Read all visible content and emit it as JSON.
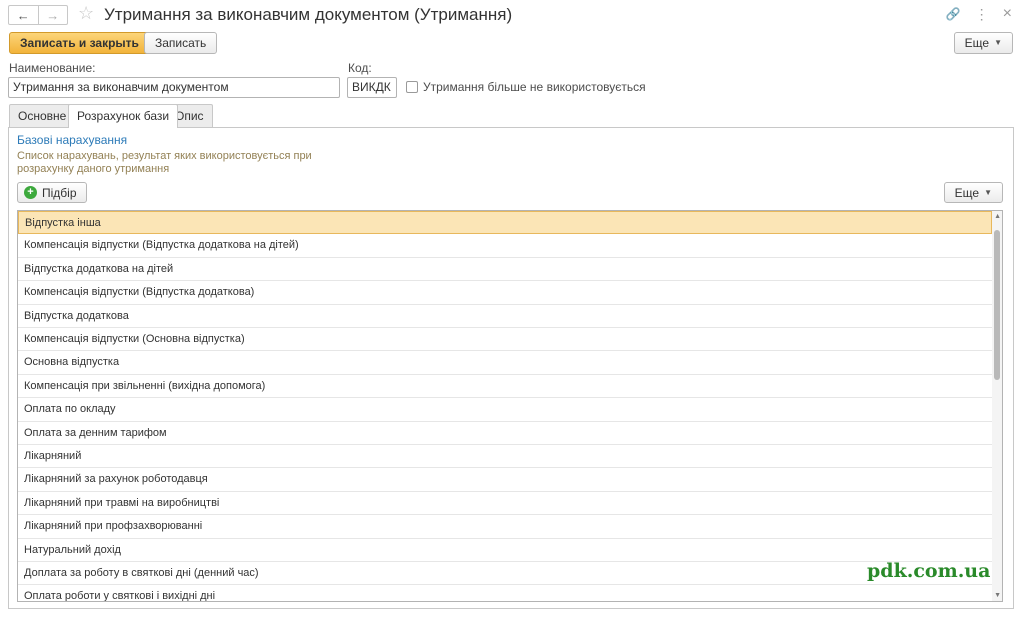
{
  "window": {
    "title": "Утримання за виконавчим документом (Утримання)"
  },
  "toolbar": {
    "save_close_label": "Записать и закрыть",
    "save_label": "Записать",
    "more_label": "Еще"
  },
  "form": {
    "name_label": "Наименование:",
    "name_value": "Утримання за виконавчим документом",
    "code_label": "Код:",
    "code_value": "ВИКДК",
    "unused_checkbox_label": "Утримання більше не використовується"
  },
  "tabs": [
    {
      "label": "Основне"
    },
    {
      "label": "Розрахунок бази"
    },
    {
      "label": "Опис"
    }
  ],
  "base_section": {
    "link": "Базові нарахування",
    "description": "Список нарахувань, результат яких використовується при розрахунку даного утримання",
    "pick_label": "Підбір",
    "more_label": "Еще"
  },
  "list_items": [
    "Відпустка інша",
    "Компенсація відпустки (Відпустка додаткова на дітей)",
    "Відпустка додаткова на дітей",
    "Компенсація відпустки (Відпустка додаткова)",
    "Відпустка додаткова",
    "Компенсація відпустки (Основна відпустка)",
    "Основна відпустка",
    "Компенсація при звільненні (вихідна допомога)",
    "Оплата по окладу",
    "Оплата за денним тарифом",
    "Лікарняний",
    "Лікарняний за рахунок роботодавця",
    "Лікарняний при травмі на виробництві",
    "Лікарняний при профзахворюванні",
    "Натуральний дохід",
    "Доплата за роботу в святкові дні (денний час)",
    "Оплата роботи у святкові і вихідні дні"
  ],
  "icons": {
    "back": "←",
    "forward": "→",
    "star": "☆",
    "link": "🔗",
    "menu": "⋮",
    "close": "×",
    "plus": "+",
    "caret": "▼"
  },
  "colors": {
    "primary": "#f2b33a",
    "selected_row": "#fbe5b6",
    "link": "#2d7bb8",
    "watermark": "#2a8a2a"
  },
  "watermark": "pdk.com.ua"
}
